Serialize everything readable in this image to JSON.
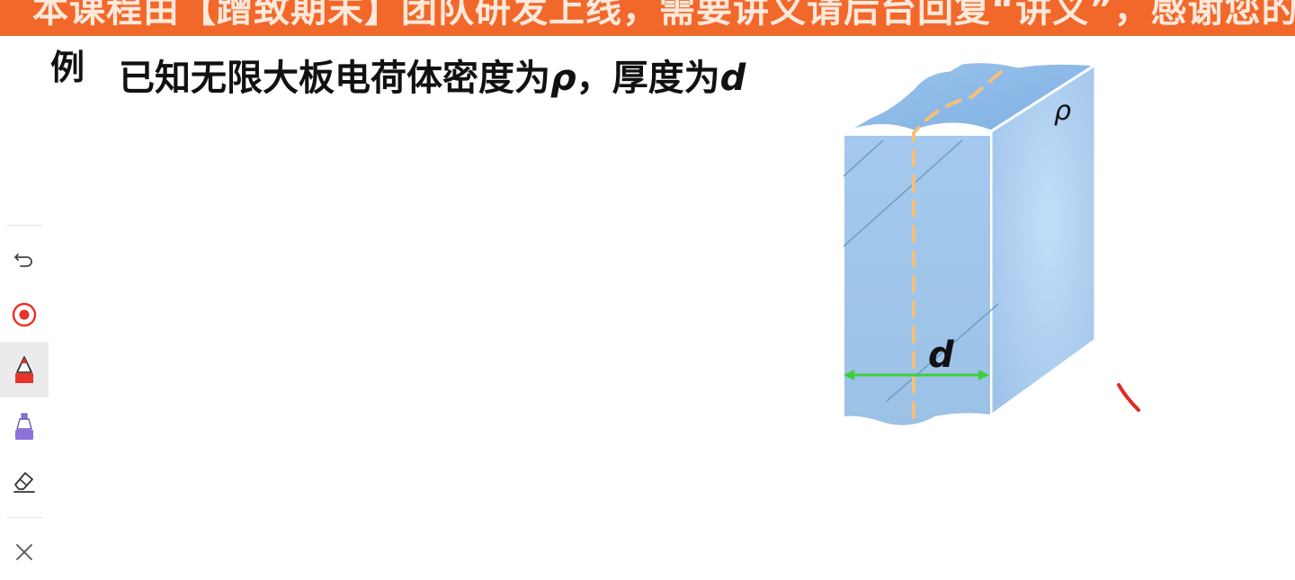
{
  "banner": {
    "text": "本课程由【蹭致期末】团队研发上线，需要讲义请后台回复“讲义”，感谢您的支持"
  },
  "problem": {
    "label": "例",
    "text_main": "已知无限大板电荷体密度为",
    "symbol_rho": "ρ",
    "text_sep": "，厚度为",
    "symbol_d": "d"
  },
  "figure": {
    "rho_label": "ρ",
    "d_label": "d"
  },
  "toolbar": {
    "tools": [
      {
        "name": "undo-icon",
        "active": false
      },
      {
        "name": "laser-pointer-icon",
        "active": false
      },
      {
        "name": "red-pen-icon",
        "active": true
      },
      {
        "name": "purple-pen-icon",
        "active": false
      },
      {
        "name": "eraser-icon",
        "active": false
      },
      {
        "name": "close-icon",
        "active": false
      }
    ]
  },
  "colors": {
    "banner": "#f2682a",
    "slab": "#a9cdef",
    "dashed_line": "#f3c07a",
    "arrow": "#3ccf3c",
    "pen_red": "#e8332b",
    "pen_purple": "#8a72d8"
  }
}
